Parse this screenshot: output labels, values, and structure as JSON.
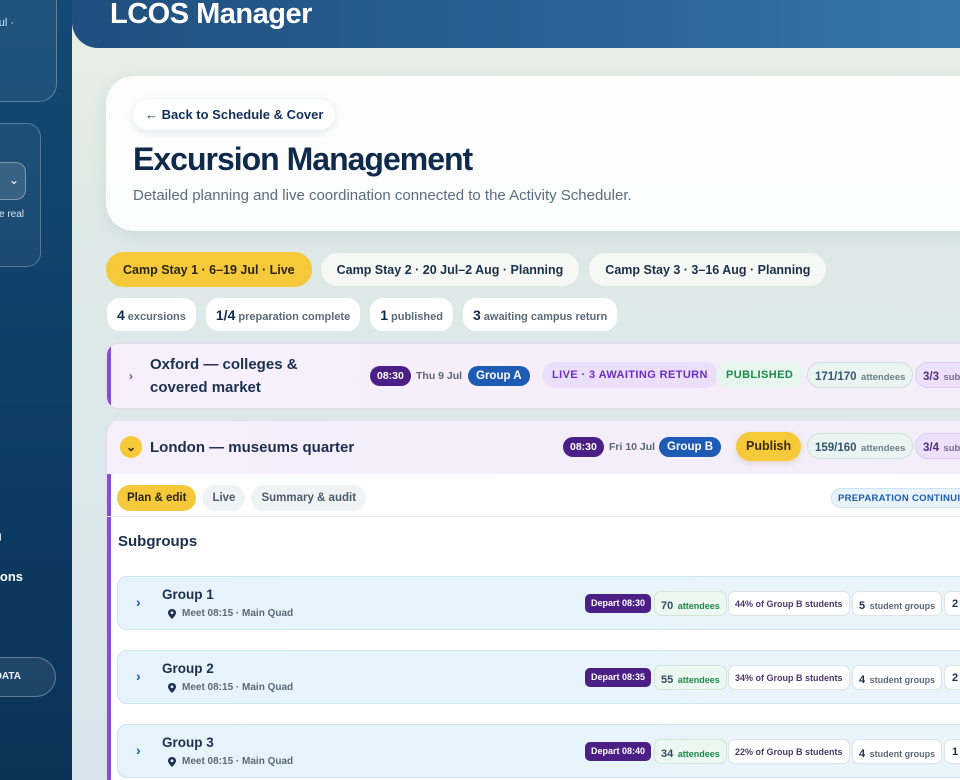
{
  "app": {
    "title": "LCOS Manager"
  },
  "sidebar": {
    "card_text": "ul ·",
    "select_hint": "e real",
    "nav_label": "ons",
    "pill_label": "DATA"
  },
  "hero": {
    "back_label": "← Back to Schedule & Cover",
    "title": "Excursion Management",
    "subtitle": "Detailed planning and live coordination connected to the Activity Scheduler."
  },
  "camp_tabs": [
    {
      "label": "Camp Stay 1 · 6–19 Jul · Live",
      "active": true
    },
    {
      "label": "Camp Stay 2 · 20 Jul–2 Aug · Planning",
      "active": false
    },
    {
      "label": "Camp Stay 3 · 3–16 Aug · Planning",
      "active": false
    }
  ],
  "stats": [
    {
      "value": "4",
      "label": "excursions"
    },
    {
      "value": "1/4",
      "label": "preparation complete"
    },
    {
      "value": "1",
      "label": "published"
    },
    {
      "value": "3",
      "label": "awaiting campus return"
    }
  ],
  "excursions": [
    {
      "name": "Oxford — colleges & covered market",
      "time": "08:30",
      "date": "Thu 9 Jul",
      "group": "Group A",
      "live_status": "LIVE · 3 AWAITING RETURN",
      "publish_status": "PUBLISHED",
      "attendees": "171/170",
      "attendees_label": "attendees",
      "subgroups": "3/3",
      "subgroups_label": "subg"
    },
    {
      "name": "London — museums quarter",
      "time": "08:30",
      "date": "Fri 10 Jul",
      "group": "Group B",
      "publish_button": "Publish",
      "attendees": "159/160",
      "attendees_label": "attendees",
      "subgroups": "3/4",
      "subgroups_label": "subg",
      "tabs": [
        "Plan & edit",
        "Live",
        "Summary & audit"
      ],
      "prep_badge": "PREPARATION CONTINUIN",
      "section_title": "Subgroups",
      "groups": [
        {
          "name": "Group 1",
          "meet": "Meet 08:15 · Main Quad",
          "depart": "Depart 08:30",
          "attendees": "70",
          "attendees_label": "attendees",
          "share": "44% of Group B students",
          "student_groups": "5",
          "student_groups_label": "student groups",
          "extra": "2"
        },
        {
          "name": "Group 2",
          "meet": "Meet 08:15 · Main Quad",
          "depart": "Depart 08:35",
          "attendees": "55",
          "attendees_label": "attendees",
          "share": "34% of Group B students",
          "student_groups": "4",
          "student_groups_label": "student groups",
          "extra": "2"
        },
        {
          "name": "Group 3",
          "meet": "Meet 08:15 · Main Quad",
          "depart": "Depart 08:40",
          "attendees": "34",
          "attendees_label": "attendees",
          "share": "22% of Group B students",
          "student_groups": "4",
          "student_groups_label": "student groups",
          "extra": "1"
        }
      ]
    }
  ],
  "icons": {
    "collapsed": "›",
    "expanded": "⌄",
    "select_chevron": "⌄"
  },
  "colors": {
    "accent_yellow": "#f6c93b",
    "purple": "#4b1f85",
    "blue": "#1d5bb5",
    "sidebar": "#134a75"
  }
}
